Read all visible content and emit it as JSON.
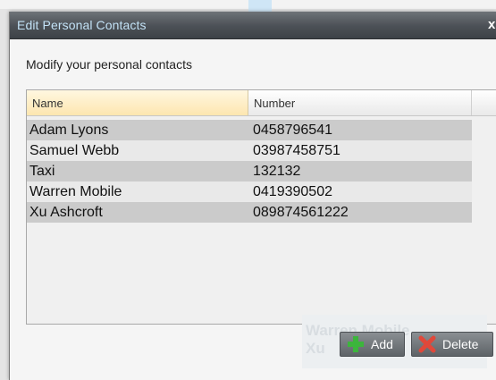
{
  "dialog": {
    "title": "Edit Personal Contacts",
    "close_label": "x",
    "subtitle": "Modify your personal contacts"
  },
  "grid": {
    "columns": [
      "Name",
      "Number"
    ],
    "rows": [
      {
        "name": "Adam Lyons",
        "number": "0458796541"
      },
      {
        "name": "Samuel Webb",
        "number": "03987458751"
      },
      {
        "name": "Taxi",
        "number": "132132"
      },
      {
        "name": "Warren Mobile",
        "number": "0419390502"
      },
      {
        "name": "Xu Ashcroft",
        "number": "089874561222"
      }
    ]
  },
  "background": {
    "ghost_line_1": "Warren Mobile",
    "ghost_line_2": "Xu"
  },
  "buttons": {
    "add_label": "Add",
    "add_icon": "plus-icon",
    "delete_label": "Delete",
    "delete_icon": "cross-icon"
  },
  "colors": {
    "titlebar": "#4b5056",
    "title_text": "#c3e2f6",
    "header_highlight": "#fde6b0",
    "row_odd": "#cbcbcb",
    "row_even": "#e9e9e9",
    "add_icon_color": "#3cb53c",
    "delete_icon_color": "#e0483a"
  }
}
